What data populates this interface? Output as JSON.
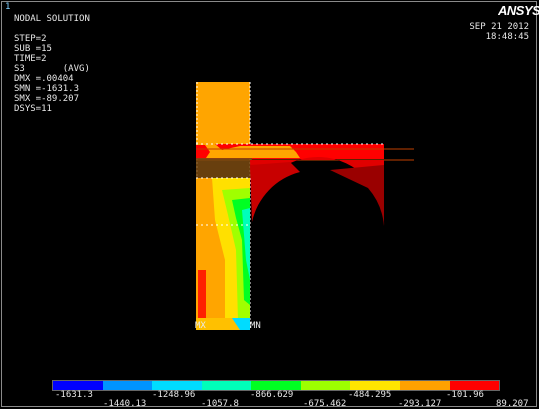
{
  "window": {
    "number": "1",
    "logo": "ANSYS"
  },
  "result": {
    "lines": [
      "NODAL SOLUTION",
      "",
      "STEP=2",
      "SUB =15",
      "TIME=2",
      "S3       (AVG)",
      "DMX =.00404",
      "SMN =-1631.3",
      "SMX =-89.207",
      "DSYS=11"
    ]
  },
  "timestamp": {
    "date": "SEP 21 2012",
    "time": "18:48:45"
  },
  "markers": {
    "mx": "MX",
    "mn": "MN"
  },
  "legend": {
    "colors": [
      "#0000ff",
      "#0094ff",
      "#00dcff",
      "#00ffb9",
      "#00ff22",
      "#9dff00",
      "#ffe500",
      "#ffa100",
      "#ff0000"
    ],
    "labels_top": [
      "-1631.3",
      "-1248.96",
      "-866.629",
      "-484.295",
      "-101.96"
    ],
    "labels_bottom": [
      "-1440.13",
      "-1057.8",
      "-675.462",
      "-293.127",
      "89.207"
    ]
  }
}
